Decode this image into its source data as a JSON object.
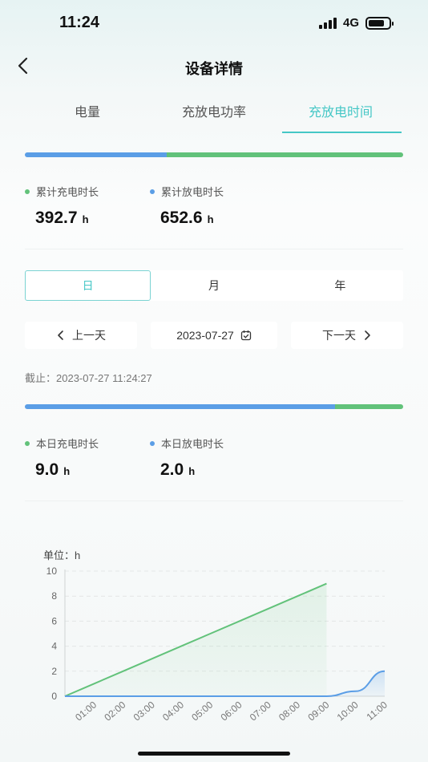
{
  "status_bar": {
    "time": "11:24",
    "network": "4G",
    "battery_level": 0.8
  },
  "nav": {
    "title": "设备详情",
    "back_icon": "chevron-left-icon"
  },
  "tabs": [
    {
      "label": "电量",
      "active": false
    },
    {
      "label": "充放电功率",
      "active": false
    },
    {
      "label": "充放电时间",
      "active": true
    }
  ],
  "colors": {
    "accent": "#45c7c6",
    "charge": "#62c27a",
    "discharge": "#5b9ee6"
  },
  "total": {
    "charge_ratio": 0.376,
    "charge_label": "累计充电时长",
    "discharge_label": "累计放电时长",
    "charge_value": "392.7",
    "discharge_value": "652.6",
    "unit": "h"
  },
  "period_selector": {
    "options": [
      "日",
      "月",
      "年"
    ],
    "selected": "日"
  },
  "date_nav": {
    "prev_label": "上一天",
    "date": "2023-07-27",
    "next_label": "下一天",
    "calendar_icon": "calendar-icon"
  },
  "deadline": "截止：2023-07-27 11:24:27",
  "daily": {
    "discharge_ratio": 0.82,
    "charge_label": "本日充电时长",
    "discharge_label": "本日放电时长",
    "charge_value": "9.0",
    "discharge_value": "2.0",
    "unit": "h"
  },
  "chart_unit_label": "单位：h",
  "chart_data": {
    "type": "area",
    "x": [
      "00:00",
      "01:00",
      "02:00",
      "03:00",
      "04:00",
      "05:00",
      "06:00",
      "07:00",
      "08:00",
      "09:00",
      "10:00",
      "11:00"
    ],
    "x_tick_labels": [
      "01:00",
      "02:00",
      "03:00",
      "04:00",
      "05:00",
      "06:00",
      "07:00",
      "08:00",
      "09:00",
      "10:00",
      "11:00"
    ],
    "series": [
      {
        "color": "#62c27a",
        "values": [
          0,
          1,
          2,
          3,
          4,
          5,
          6,
          7,
          8,
          9,
          null,
          null
        ]
      },
      {
        "color": "#5b9ee6",
        "values": [
          0,
          0,
          0,
          0,
          0,
          0,
          0,
          0,
          0,
          0,
          0.4,
          2.0
        ]
      }
    ],
    "ylim": [
      0,
      10
    ],
    "y_ticks": [
      0,
      2,
      4,
      6,
      8,
      10
    ],
    "grid": true,
    "title": "",
    "xlabel": "",
    "ylabel": "单位：h"
  }
}
